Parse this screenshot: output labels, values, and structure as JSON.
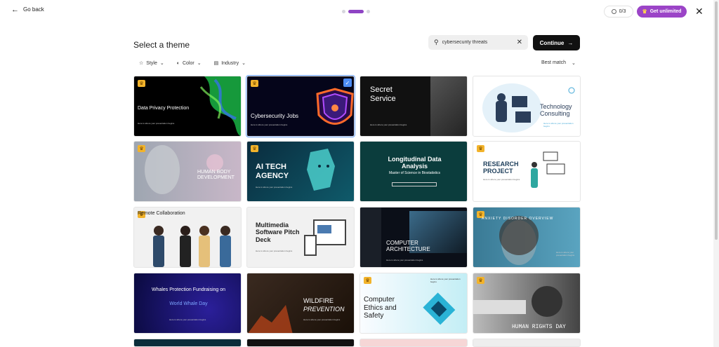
{
  "topbar": {
    "back_label": "Go back",
    "credits": "0/3",
    "unlimited_label": "Get unlimited"
  },
  "page": {
    "title": "Select a theme",
    "search_value": "cybersecurity threats",
    "continue_label": "Continue"
  },
  "filters": {
    "style": "Style",
    "color": "Color",
    "industry": "Industry",
    "sort": "Best match"
  },
  "cards": [
    {
      "title": "Data Privacy Protection",
      "sub": "Here is where your presentation begins",
      "premium": true
    },
    {
      "title": "Cybersecurity Jobs",
      "sub": "Here is where your presentation begins",
      "premium": true,
      "selected": true
    },
    {
      "title": "Secret Service",
      "sub": "Here is where your presentation begins",
      "premium": false
    },
    {
      "title": "Technology Consulting",
      "sub": "Here is where your presentation begins",
      "premium": false
    },
    {
      "title": "HUMAN BODY DEVELOPMENT",
      "sub": "",
      "premium": true
    },
    {
      "title": "AI TECH AGENCY",
      "sub": "Here is where your presentation begins",
      "premium": true
    },
    {
      "title": "Longitudinal Data Analysis",
      "sub": "Master of Science in Biostatistics",
      "premium": false
    },
    {
      "title": "RESEARCH PROJECT",
      "sub": "Here is where your presentation begins",
      "premium": true
    },
    {
      "title": "Remote Collaboration",
      "sub": "Here is where your presentation begins",
      "premium": true
    },
    {
      "title": "Multimedia Software Pitch Deck",
      "sub": "Here is where your presentation begins",
      "premium": false
    },
    {
      "title": "COMPUTER ARCHITECTURE",
      "sub": "Here is where your presentation begins",
      "premium": false
    },
    {
      "title": "ANXIETY DISORDER OVERVIEW",
      "sub": "Here is where your presentation begins",
      "premium": true
    },
    {
      "title": "Whales Protection Fundraising on",
      "title2": "World Whale Day",
      "sub": "Here is where your presentation begins",
      "premium": false
    },
    {
      "title": "WILDFIRE",
      "title2": "PREVENTION",
      "sub": "Here is where your presentation begins",
      "premium": false
    },
    {
      "title": "Computer Ethics and Safety",
      "sub": "Here is where your presentation begins",
      "premium": true
    },
    {
      "title": "HUMAN RIGHTS DAY",
      "sub": "",
      "premium": true
    }
  ],
  "colors": {
    "accent": "#9b44c7",
    "selected": "#4c8cf5",
    "crown": "#f2b32b"
  }
}
